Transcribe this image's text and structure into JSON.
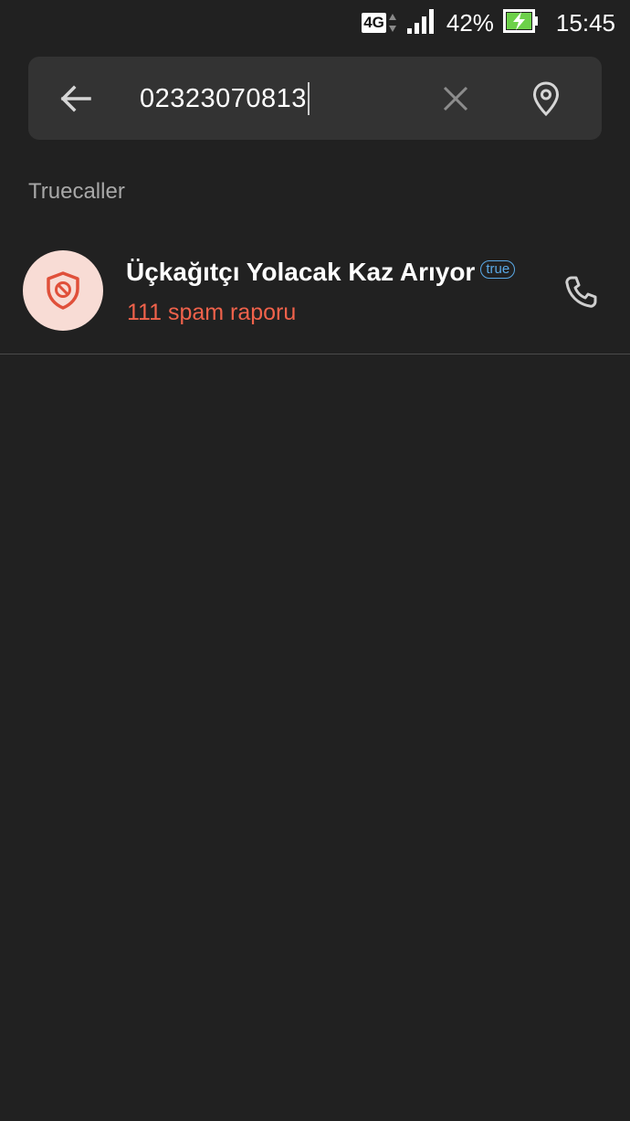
{
  "status_bar": {
    "network_type": "4G",
    "battery_percent": "42%",
    "time": "15:45",
    "colors": {
      "battery_charge": "#6dd14a"
    }
  },
  "search": {
    "query": "02323070813",
    "icons": {
      "back": "arrow-left-icon",
      "clear": "close-icon",
      "location": "location-pin-icon"
    }
  },
  "section": {
    "title": "Truecaller"
  },
  "result": {
    "name": "Üçkağıtçı Yolacak Kaz Arıyor",
    "badge": "true",
    "subtitle": "111 spam raporu",
    "avatar_icon": "shield-block-icon",
    "action_icon": "phone-icon",
    "colors": {
      "spam": "#f0624b",
      "avatar_bg": "#f8dcd5",
      "badge": "#5aa9e6"
    }
  }
}
